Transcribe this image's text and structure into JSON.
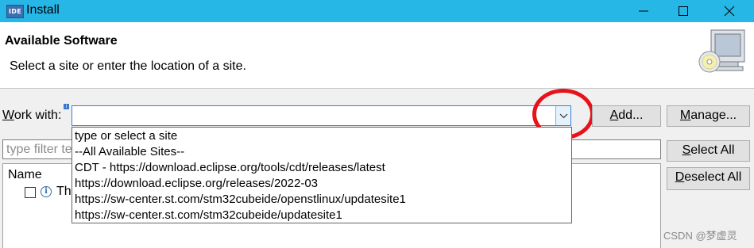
{
  "window": {
    "app_icon_text": "IDE",
    "title": "Install",
    "controls": [
      "minimize",
      "maximize",
      "close"
    ]
  },
  "header": {
    "title": "Available Software",
    "description": "Select a site or enter the location of a site."
  },
  "work_with": {
    "label_prefix": "W",
    "label_rest": "ork with:",
    "value": ""
  },
  "buttons": {
    "add": {
      "mnemonic": "A",
      "rest": "dd..."
    },
    "manage": {
      "mnemonic": "M",
      "rest": "anage..."
    },
    "select_all": {
      "mnemonic": "S",
      "rest": "elect All"
    },
    "deselect_all": {
      "mnemonic": "D",
      "rest": "eselect All"
    }
  },
  "filter": {
    "placeholder": "type filter te"
  },
  "table": {
    "column_name": "Name",
    "row_text": "Th"
  },
  "dropdown": {
    "items": [
      "type or select a site",
      "--All Available Sites--",
      "CDT - https://download.eclipse.org/tools/cdt/releases/latest",
      "https://download.eclipse.org/releases/2022-03",
      "https://sw-center.st.com/stm32cubeide/openstlinux/updatesite1",
      "https://sw-center.st.com/stm32cubeide/updatesite1"
    ]
  },
  "watermark": "CSDN @梦虚灵",
  "colors": {
    "titlebar": "#27b7e6",
    "highlight_circle": "#e8121b",
    "focus_border": "#3b7fd6"
  }
}
